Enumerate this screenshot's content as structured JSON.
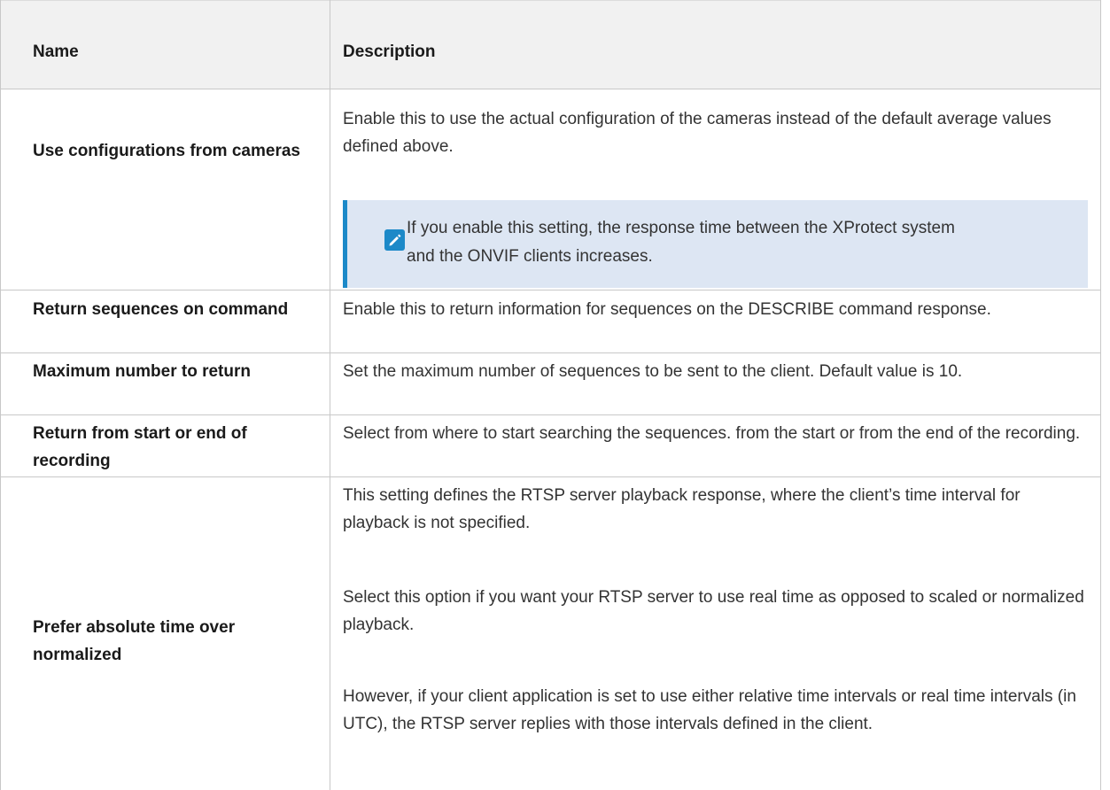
{
  "header": {
    "name": "Name",
    "description": "Description"
  },
  "rows": [
    {
      "name": "Use configurations from cameras",
      "description": "Enable this to use the actual configuration of the cameras instead of the default average values defined above.",
      "note": {
        "icon": "pencil-icon",
        "text": "If you enable this setting, the response time between the XProtect system and the ONVIF clients increases."
      }
    },
    {
      "name": "Return sequences on command",
      "description": "Enable this to return information for sequences on the DESCRIBE command response."
    },
    {
      "name": "Maximum number to return",
      "description": "Set the maximum number of sequences to be sent to the client. Default value is 10."
    },
    {
      "name": "Return from start or end of recording",
      "description": "Select from where to start searching the sequences. from the start or from the end of the recording."
    },
    {
      "name": "Prefer absolute time over normalized",
      "paragraphs": [
        "This setting defines the RTSP server playback response, where the client’s time interval for playback is not specified.",
        "Select this option if you want your RTSP server to use real time as opposed to scaled or normalized playback.",
        "However, if your client application is set to use either relative time intervals or real time intervals (in UTC), the RTSP server replies with those intervals defined in the client."
      ]
    }
  ],
  "colors": {
    "header_bg": "#f1f1f1",
    "note_bg": "#dde6f3",
    "accent": "#1c89c8"
  }
}
